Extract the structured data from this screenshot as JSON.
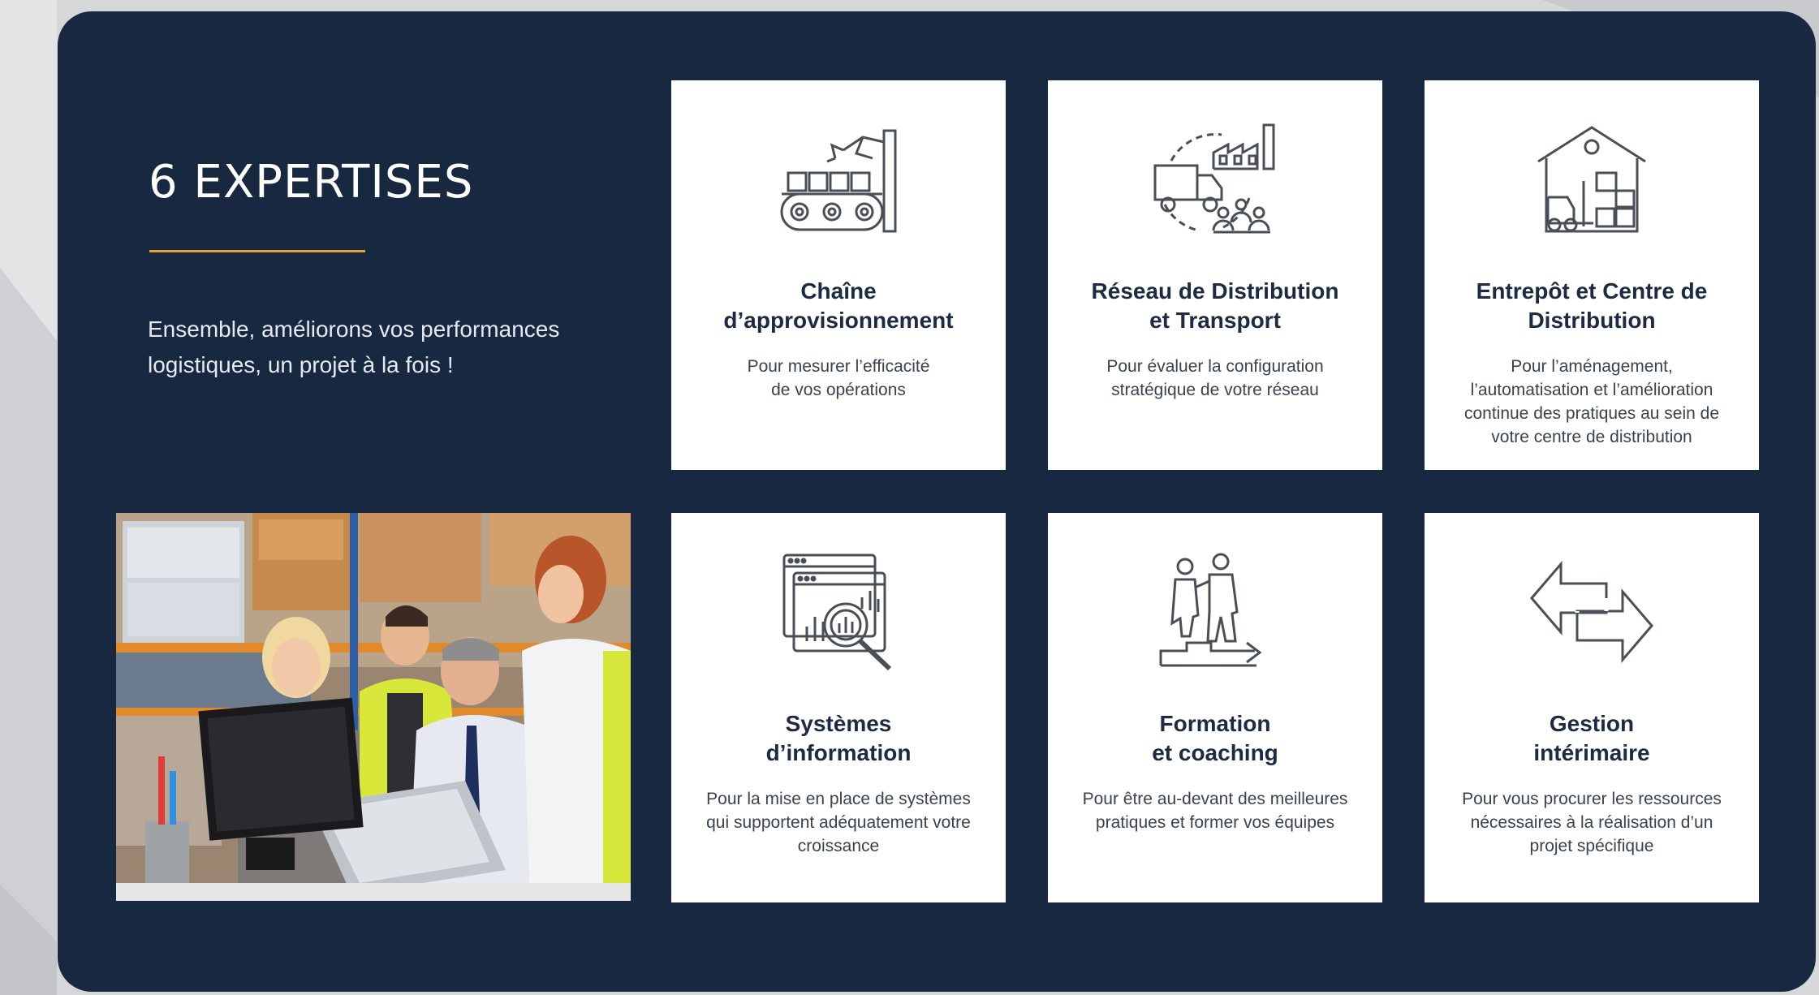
{
  "section": {
    "heading": "6 EXPERTISES",
    "intro": "Ensemble, améliorons vos performances logistiques, un projet à la fois !"
  },
  "colors": {
    "panel": "#172840",
    "accent": "#e9a13b",
    "card": "#ffffff",
    "title": "#1c2a42"
  },
  "photo": {
    "description": "warehouse-team-photo"
  },
  "cards": [
    {
      "icon": "conveyor-robot-arm-icon",
      "title": "Chaîne\nd’approvisionnement",
      "desc": "Pour mesurer l’efficacité\nde vos opérations"
    },
    {
      "icon": "truck-factory-network-icon",
      "title": "Réseau de Distribution\net Transport",
      "desc": "Pour évaluer la configuration\nstratégique de votre réseau"
    },
    {
      "icon": "warehouse-forklift-icon",
      "title": "Entrepôt et Centre de\nDistribution",
      "desc": "Pour l’aménagement,\nl’automatisation et l’amélioration\ncontinue des pratiques au sein de\nvotre centre de distribution"
    },
    {
      "icon": "data-analysis-magnifier-icon",
      "title": "Systèmes\nd’information",
      "desc": "Pour la mise en place de systèmes\nqui supportent adéquatement votre\ncroissance"
    },
    {
      "icon": "training-people-stairs-icon",
      "title": "Formation\net coaching",
      "desc": "Pour être au-devant des meilleures\npratiques et former vos équipes"
    },
    {
      "icon": "exchange-arrows-icon",
      "title": "Gestion\nintérimaire",
      "desc": "Pour vous procurer les ressources\nnécessaires à la réalisation d’un\nprojet spécifique"
    }
  ]
}
